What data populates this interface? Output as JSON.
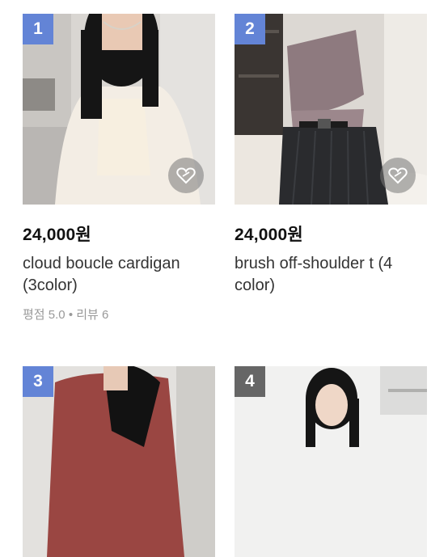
{
  "products": [
    {
      "rank": "1",
      "price": "24,000원",
      "name": "cloud boucle cardigan (3color)",
      "rating_label": "평점",
      "rating": "5.0",
      "dot": "•",
      "reviews_label": "리뷰",
      "reviews": "6",
      "badge_color": "#6384d6"
    },
    {
      "rank": "2",
      "price": "24,000원",
      "name": "brush off-shoulder t (4 color)",
      "badge_color": "#6384d6"
    },
    {
      "rank": "3",
      "badge_color": "#6384d6"
    },
    {
      "rank": "4",
      "badge_color": "#666666"
    }
  ],
  "icons": {
    "like": "heart-outline-icon"
  }
}
